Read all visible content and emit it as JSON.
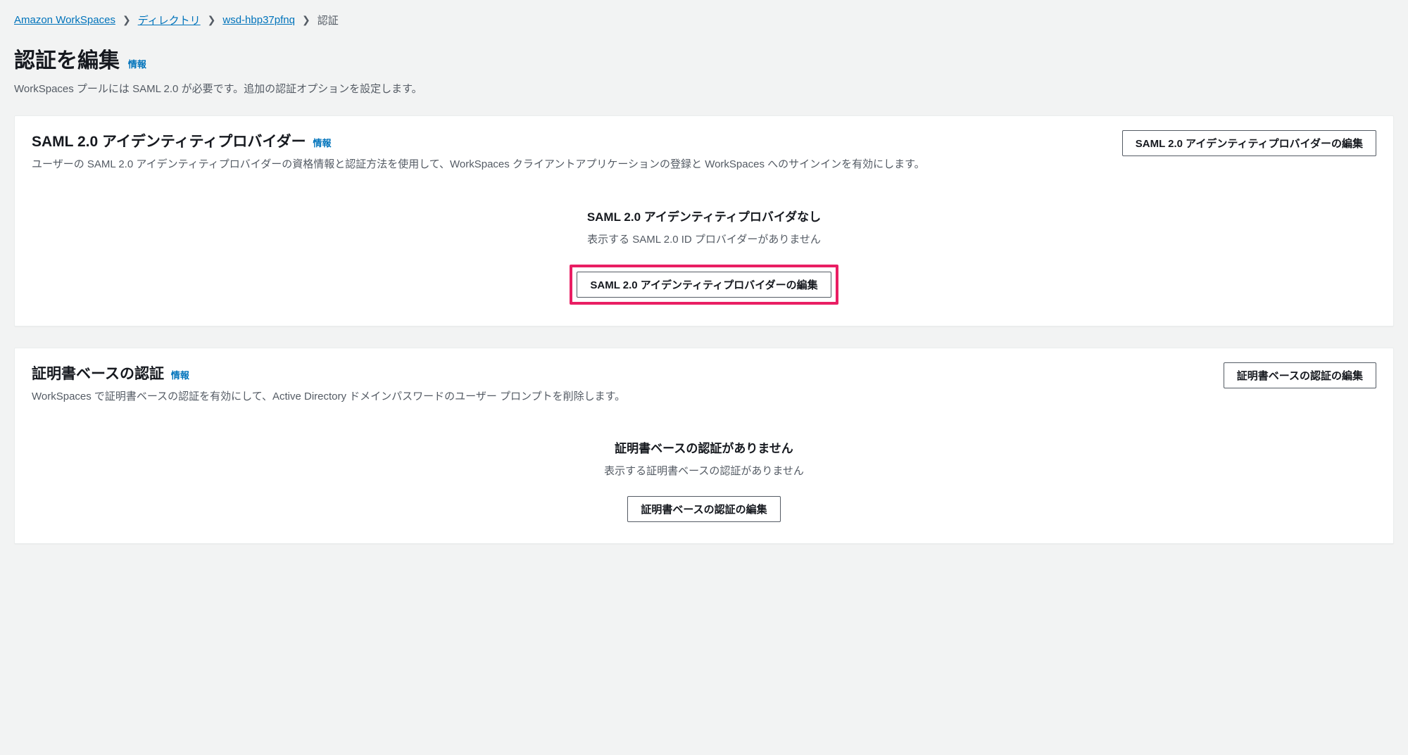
{
  "breadcrumb": {
    "items": [
      {
        "label": "Amazon WorkSpaces",
        "link": true
      },
      {
        "label": "ディレクトリ",
        "link": true
      },
      {
        "label": "wsd-hbp37pfnq",
        "link": true
      },
      {
        "label": "認証",
        "link": false
      }
    ]
  },
  "page": {
    "title": "認証を編集",
    "info": "情報",
    "description": "WorkSpaces プールには SAML 2.0 が必要です。追加の認証オプションを設定します。"
  },
  "saml": {
    "title": "SAML 2.0 アイデンティティプロバイダー",
    "info": "情報",
    "description": "ユーザーの SAML 2.0 アイデンティティプロバイダーの資格情報と認証方法を使用して、WorkSpaces クライアントアプリケーションの登録と WorkSpaces へのサインインを有効にします。",
    "edit_button": "SAML 2.0 アイデンティティプロバイダーの編集",
    "empty": {
      "title": "SAML 2.0 アイデンティティプロバイダなし",
      "description": "表示する SAML 2.0 ID プロバイダーがありません",
      "button": "SAML 2.0 アイデンティティプロバイダーの編集"
    }
  },
  "cert": {
    "title": "証明書ベースの認証",
    "info": "情報",
    "description": "WorkSpaces で証明書ベースの認証を有効にして、Active Directory ドメインパスワードのユーザー プロンプトを削除します。",
    "edit_button": "証明書ベースの認証の編集",
    "empty": {
      "title": "証明書ベースの認証がありません",
      "description": "表示する証明書ベースの認証がありません",
      "button": "証明書ベースの認証の編集"
    }
  }
}
